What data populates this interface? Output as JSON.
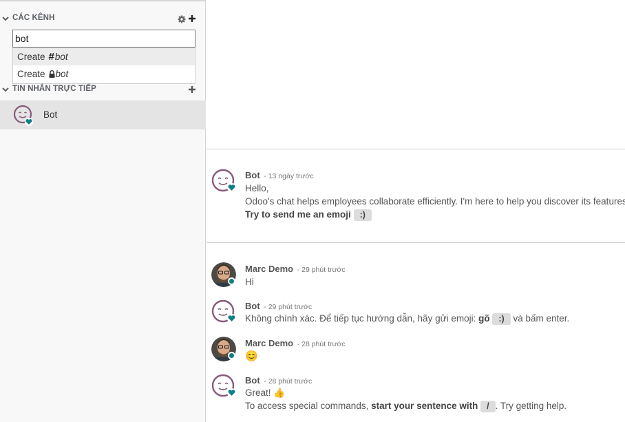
{
  "sidebar": {
    "channels_title": "CÁC KÊNH",
    "search_value": "bot",
    "dropdown": [
      {
        "prefix": "Create",
        "name": "bot",
        "type": "public"
      },
      {
        "prefix": "Create",
        "name": "bot",
        "type": "private"
      }
    ],
    "direct_title": "TIN NHẮN TRỰC TIẾP",
    "direct_items": [
      {
        "name": "Bot"
      }
    ]
  },
  "messages": [
    {
      "author": "Bot",
      "date": "- 13 ngày trước",
      "line1": "Hello,",
      "line2": "Odoo's chat helps employees collaborate efficiently. I'm here to help you discover its features.",
      "line3_bold": "Try to send me an emoji",
      "line3_key": ":)"
    },
    {
      "author": "Marc Demo",
      "date": "- 29 phút trước",
      "text": "Hi"
    },
    {
      "author": "Bot",
      "date": "- 29 phút trước",
      "text_before": "Không chính xác. Để tiếp tục hướng dẫn, hãy gửi emoji: ",
      "text_bold": "gõ",
      "key": ":)",
      "text_after": " và bấm enter."
    },
    {
      "author": "Marc Demo",
      "date": "- 28 phút trước",
      "emoji": "😊"
    },
    {
      "author": "Bot",
      "date": "- 28 phút trước",
      "line1": "Great!",
      "line1_emoji": "👍",
      "line2_before": "To access special commands, ",
      "line2_bold": "start your sentence with",
      "line2_key": "/",
      "line2_after": ". Try getting help."
    }
  ],
  "colors": {
    "accent": "#0e7f85",
    "bot_purple": "#875a7b"
  }
}
